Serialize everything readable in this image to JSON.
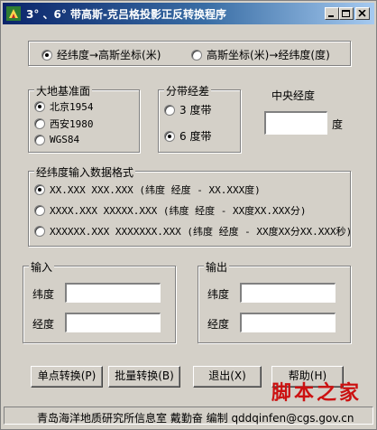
{
  "window": {
    "title": "3° 、6° 带高斯-克吕格投影正反转换程序"
  },
  "direction": {
    "option1": "经纬度→高斯坐标(米)",
    "option2": "高斯坐标(米)→经纬度(度)",
    "selected": "option1"
  },
  "datum": {
    "legend": "大地基准面",
    "items": [
      "北京1954",
      "西安1980",
      "WGS84"
    ],
    "selected_index": 0
  },
  "zone": {
    "legend": "分带经差",
    "items": [
      "3 度带",
      "6 度带"
    ],
    "selected_index": 1
  },
  "central_meridian": {
    "label": "中央经度",
    "unit": "度",
    "value": ""
  },
  "format": {
    "legend": "经纬度输入数据格式",
    "items": [
      "XX.XXX  XXX.XXX (纬度 经度 - XX.XXX度)",
      "XXXX.XXX  XXXXX.XXX (纬度 经度 - XX度XX.XXX分)",
      "XXXXXX.XXX  XXXXXXX.XXX (纬度 经度 - XX度XX分XX.XXX秒)"
    ],
    "selected_index": 0
  },
  "input": {
    "legend": "输入",
    "lat_label": "纬度",
    "lon_label": "经度",
    "lat_value": "",
    "lon_value": ""
  },
  "output": {
    "legend": "输出",
    "lat_label": "纬度",
    "lon_label": "经度",
    "lat_value": "",
    "lon_value": ""
  },
  "buttons": {
    "single": "单点转换(P)",
    "batch": "批量转换(B)",
    "exit": "退出(X)",
    "help": "帮助(H)"
  },
  "status": "青岛海洋地质研究所信息室 戴勤奋 编制 qddqinfen@cgs.gov.cn",
  "watermark": "脚本之家"
}
